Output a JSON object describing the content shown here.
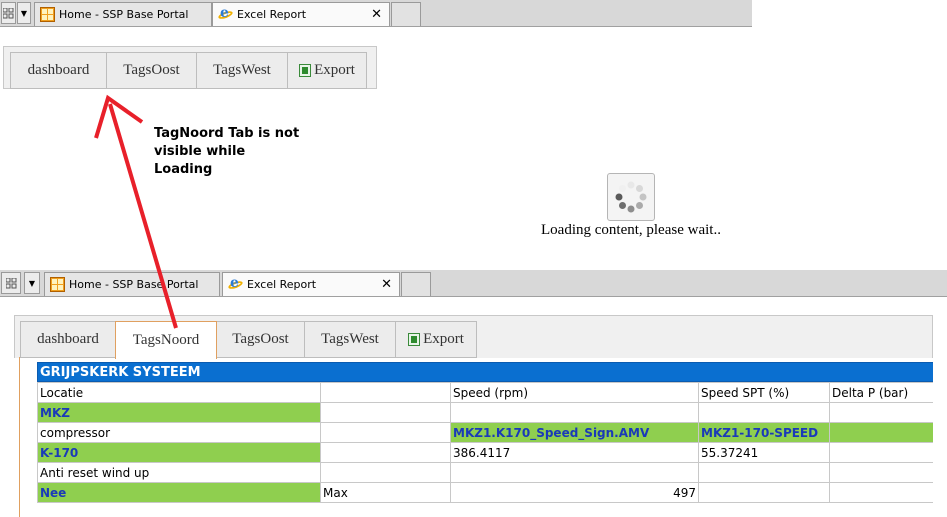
{
  "browser_top": {
    "tabs": [
      {
        "label": "Home - SSP Base Portal",
        "active": false
      },
      {
        "label": "Excel Report",
        "active": true
      }
    ]
  },
  "browser_bottom": {
    "tabs": [
      {
        "label": "Home - SSP Base Portal",
        "active": false
      },
      {
        "label": "Excel Report",
        "active": true
      }
    ]
  },
  "app_tabs_loading": [
    "dashboard",
    "TagsOost",
    "TagsWest",
    "Export"
  ],
  "app_tabs_loaded": [
    "dashboard",
    "TagsNoord",
    "TagsOost",
    "TagsWest",
    "Export"
  ],
  "annotation": "TagNoord Tab is not visible while Loading",
  "loading": {
    "text": "Loading content, please wait.."
  },
  "report": {
    "title": "GRIJPSKERK SYSTEEM",
    "headers": [
      "Locatie",
      "",
      "Speed (rpm)",
      "Speed SPT (%)",
      "Delta P (bar)"
    ],
    "rows": [
      [
        "MKZ",
        "",
        "",
        "",
        ""
      ],
      [
        "compressor",
        "",
        "MKZ1.K170_Speed_Sign.AMV",
        "MKZ1-170-SPEED",
        ""
      ],
      [
        "K-170",
        "",
        "386.4117",
        "55.37241",
        ""
      ],
      [
        "Anti reset wind up",
        "",
        "",
        "",
        ""
      ],
      [
        "Nee",
        "Max",
        "497",
        "",
        ""
      ]
    ]
  },
  "colors": {
    "accent_blue": "#0a6fd0",
    "row_green": "#8fcf4f",
    "annotation_red": "#e8202a"
  }
}
